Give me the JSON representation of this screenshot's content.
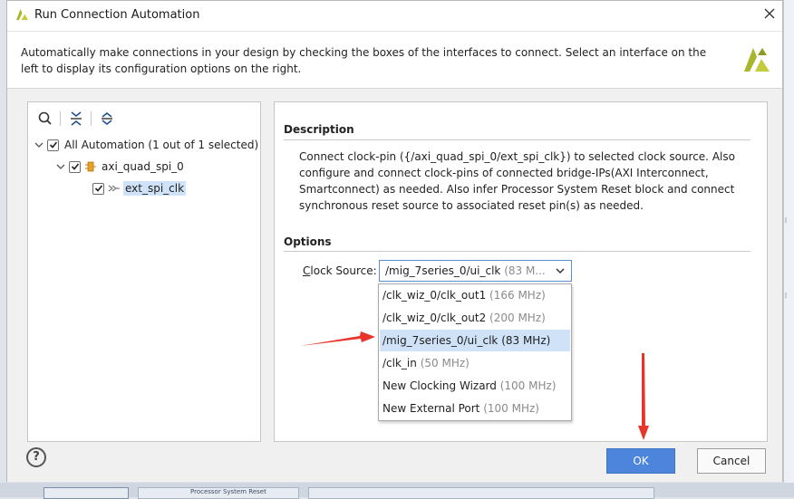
{
  "dialog": {
    "title": "Run Connection Automation",
    "header_text": "Automatically make connections in your design by checking the boxes of the interfaces to connect. Select an interface on the left to display its configuration options on the right."
  },
  "tree": {
    "root": {
      "label": "All Automation (1 out of 1 selected)",
      "checked": true,
      "expanded": true
    },
    "child": {
      "label": "axi_quad_spi_0",
      "checked": true,
      "expanded": true
    },
    "leaf": {
      "label": "ext_spi_clk",
      "checked": true,
      "selected": true
    }
  },
  "description": {
    "title": "Description",
    "text": "Connect clock-pin ({/axi_quad_spi_0/ext_spi_clk}) to selected clock source. Also configure and connect clock-pins of connected bridge-IPs(AXI Interconnect, Smartconnect) as needed. Also infer Processor System Reset block and connect synchronous reset source to associated reset pin(s) as needed."
  },
  "options": {
    "title": "Options",
    "clock_source_label": "lock Source:",
    "clock_source_mnemonic": "C",
    "selected_value": "/mig_7series_0/ui_clk",
    "selected_freq": "(83 M...",
    "dropdown": [
      {
        "name": "/clk_wiz_0/clk_out1",
        "freq": "(166 MHz)"
      },
      {
        "name": "/clk_wiz_0/clk_out2",
        "freq": "(200 MHz)"
      },
      {
        "name": "/mig_7series_0/ui_clk",
        "freq": "(83 MHz)"
      },
      {
        "name": "/clk_in",
        "freq": "(50 MHz)"
      },
      {
        "name": "New Clocking Wizard",
        "freq": "(100 MHz)"
      },
      {
        "name": "New External Port",
        "freq": "(100 MHz)"
      }
    ],
    "selected_index": 2
  },
  "buttons": {
    "help": "?",
    "ok": "OK",
    "cancel": "Cancel"
  },
  "background": {
    "block_text": "Processor System Reset"
  },
  "colors": {
    "accent": "#4d85dc",
    "selection": "#cfe2f7",
    "annotation": "#e8352b",
    "vivado_logo": "#a9b52a"
  }
}
